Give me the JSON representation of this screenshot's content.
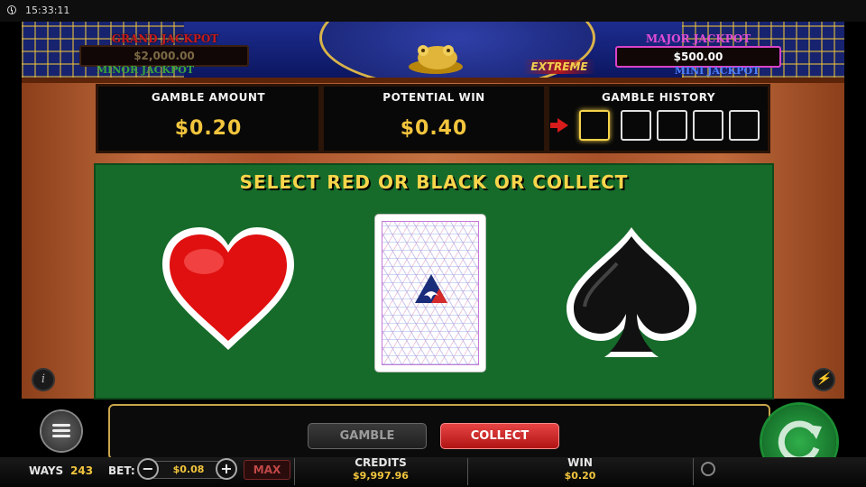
{
  "status": {
    "time": "15:33:11"
  },
  "jackpots": {
    "grand": {
      "title": "GRAND JACKPOT",
      "value": "$2,000.00"
    },
    "minor": {
      "title": "MINOR JACKPOT"
    },
    "major": {
      "title": "MAJOR JACKPOT",
      "value": "$500.00"
    },
    "mini": {
      "title": "MINI JACKPOT"
    },
    "logo_text": "EXTREME"
  },
  "panels": {
    "gamble_amount": {
      "title": "GAMBLE AMOUNT",
      "value": "$0.20"
    },
    "potential_win": {
      "title": "POTENTIAL WIN",
      "value": "$0.40"
    },
    "gamble_history": {
      "title": "GAMBLE HISTORY",
      "slots": 5
    }
  },
  "table": {
    "prompt": "SELECT RED OR BLACK OR COLLECT",
    "choices": [
      "red-heart",
      "black-spade"
    ]
  },
  "buttons": {
    "gamble": "GAMBLE",
    "collect": "COLLECT",
    "max": "MAX"
  },
  "footer": {
    "ways_label": "WAYS",
    "ways_value": "243",
    "bet_label": "BET:",
    "bet_value": "$0.08",
    "credits_label": "CREDITS",
    "credits_value": "$9,997.96",
    "win_label": "WIN",
    "win_value": "$0.20"
  },
  "colors": {
    "accent": "#f2c53d",
    "collect": "#d02020",
    "table": "#166b2a",
    "heart": "#e01010"
  },
  "icons": [
    "clock-icon",
    "info-icon",
    "turbo-icon",
    "menu-icon",
    "spin-icon",
    "history-icon",
    "toad-icon",
    "arrow-icon"
  ]
}
